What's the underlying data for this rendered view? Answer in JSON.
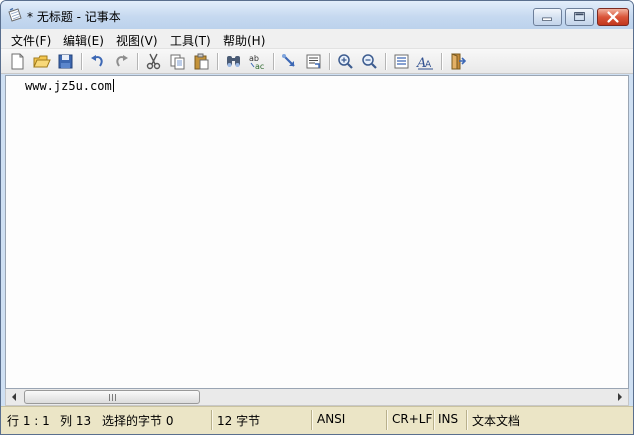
{
  "window": {
    "title": "* 无标题 - 记事本"
  },
  "menu": [
    {
      "label": "文件(F)"
    },
    {
      "label": "编辑(E)"
    },
    {
      "label": "视图(V)"
    },
    {
      "label": "工具(T)"
    },
    {
      "label": "帮助(H)"
    }
  ],
  "toolbar": {
    "icons": [
      "new-file-icon",
      "open-folder-icon",
      "save-disk-icon",
      "undo-icon",
      "redo-icon",
      "cut-icon",
      "copy-icon",
      "paste-icon",
      "find-icon",
      "replace-icon",
      "goto-icon",
      "insert-datetime-icon",
      "zoom-in-icon",
      "zoom-out-icon",
      "word-wrap-icon",
      "font-icon",
      "exit-icon"
    ]
  },
  "editor": {
    "content": "www.jz5u.com"
  },
  "statusbar": {
    "position": "行 1 : 1",
    "column": "列 13",
    "selected": "选择的字节 0",
    "bytes": "12 字节",
    "encoding": "ANSI",
    "line_ending": "CR+LF",
    "mode": "INS",
    "doc_type": "文本文档"
  },
  "colors": {
    "titlebar": "#c6d9f0",
    "statusbar": "#ebe5c6",
    "close_button": "#d9553a"
  }
}
